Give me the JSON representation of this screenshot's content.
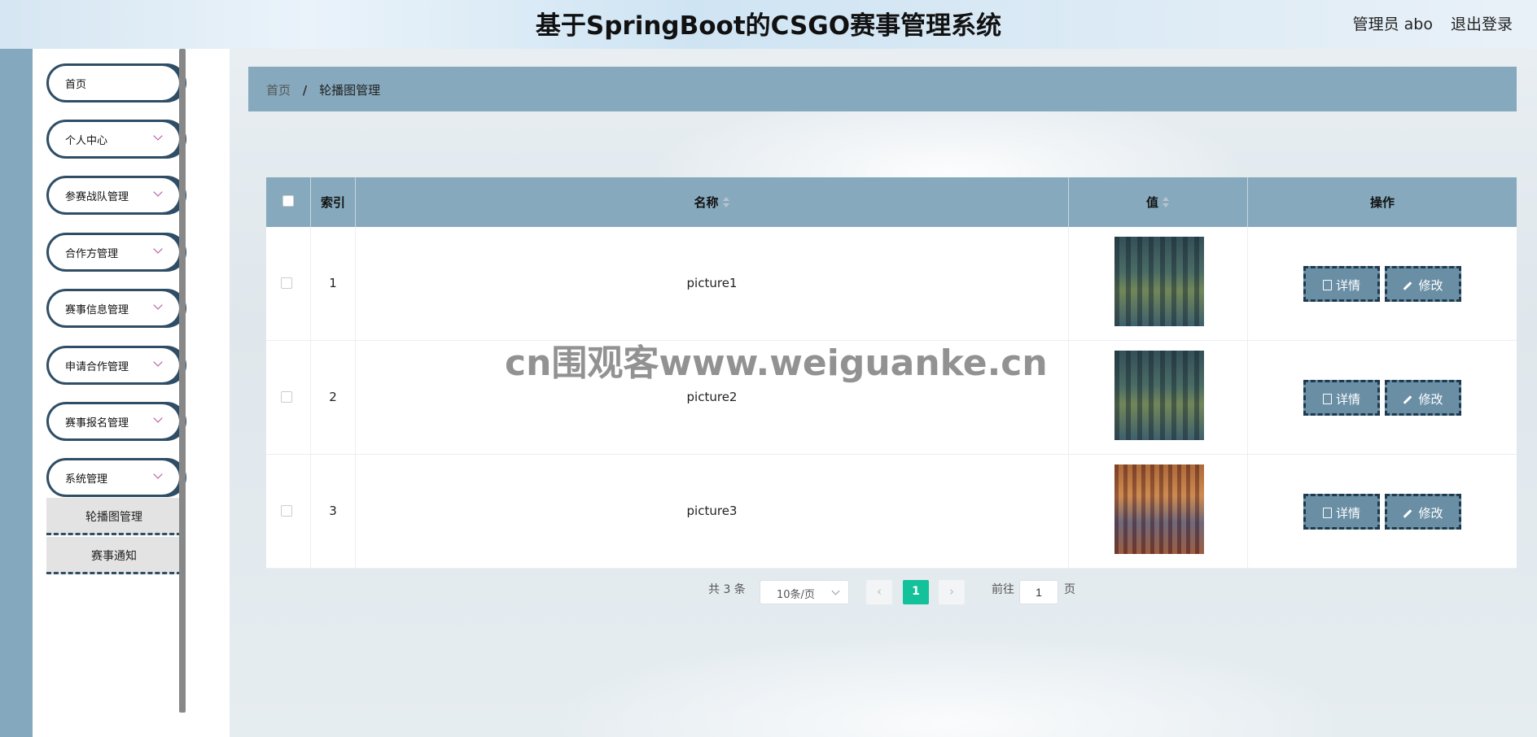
{
  "header": {
    "title": "基于SpringBoot的CSGO赛事管理系统",
    "user": "管理员 abo",
    "logout": "退出登录"
  },
  "sidebar": {
    "items": [
      {
        "label": "首页"
      },
      {
        "label": "个人中心"
      },
      {
        "label": "参赛战队管理"
      },
      {
        "label": "合作方管理"
      },
      {
        "label": "赛事信息管理"
      },
      {
        "label": "申请合作管理"
      },
      {
        "label": "赛事报名管理"
      },
      {
        "label": "系统管理"
      }
    ],
    "submenu": [
      {
        "label": "轮播图管理"
      },
      {
        "label": "赛事通知"
      }
    ]
  },
  "breadcrumb": {
    "home": "首页",
    "sep": "/",
    "current": "轮播图管理"
  },
  "table": {
    "headers": {
      "index": "索引",
      "name": "名称",
      "value": "值",
      "action": "操作"
    },
    "rows": [
      {
        "index": "1",
        "name": "picture1"
      },
      {
        "index": "2",
        "name": "picture2"
      },
      {
        "index": "3",
        "name": "picture3"
      }
    ],
    "detail_label": "详情",
    "edit_label": "修改"
  },
  "pagination": {
    "total": "共 3 条",
    "page_size": "10条/页",
    "prev": "‹",
    "current": "1",
    "next": "›",
    "goto": "前往",
    "goto_value": "1",
    "page_unit": "页"
  },
  "watermark": "cn围观客www.weiguanke.cn",
  "colors": {
    "accent": "#86a9bd",
    "dark": "#2f4e66",
    "active_page": "#13c29a"
  }
}
